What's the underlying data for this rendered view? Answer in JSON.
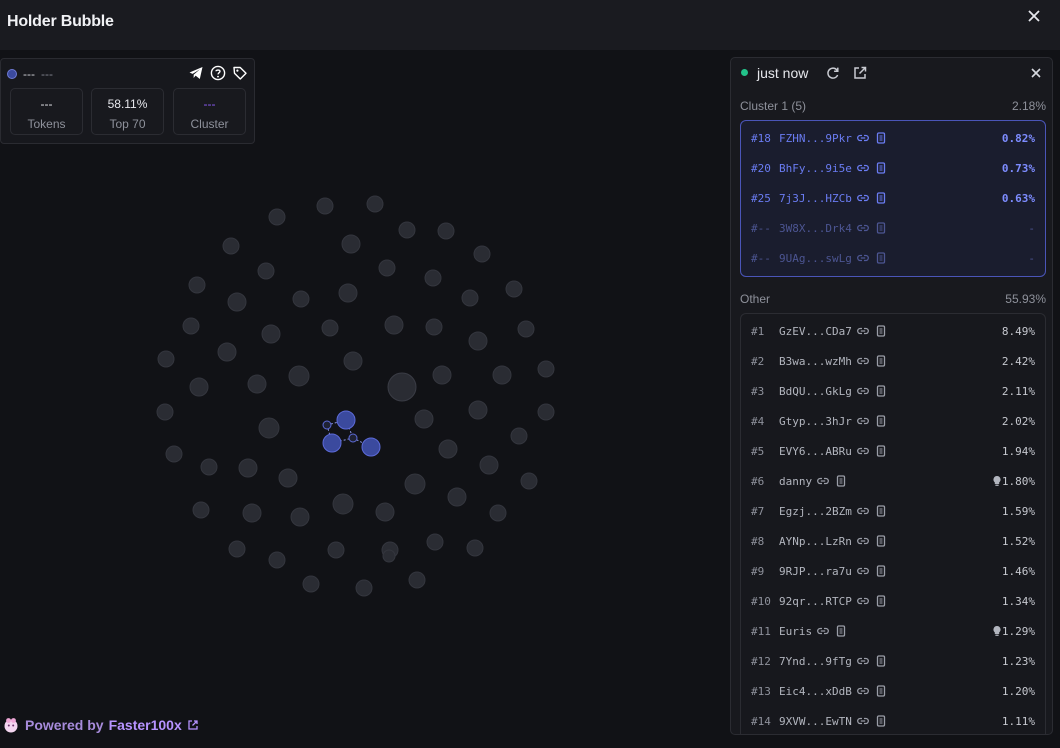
{
  "window": {
    "title": "Holder Bubble"
  },
  "stats": {
    "head_left": "---",
    "head_right": "---",
    "boxes": [
      {
        "value": "---",
        "label": "Tokens"
      },
      {
        "value": "58.11%",
        "label": "Top 70"
      },
      {
        "value": "---",
        "label": "Cluster"
      }
    ]
  },
  "footer": {
    "prefix": "Powered by",
    "brand": "Faster100x"
  },
  "panel": {
    "status": "just now",
    "cluster": {
      "title": "Cluster 1 (5)",
      "total": "2.18%",
      "rows": [
        {
          "rank": "#18",
          "addr": "FZHN...9Pkr",
          "pct": "0.82%"
        },
        {
          "rank": "#20",
          "addr": "BhFy...9i5e",
          "pct": "0.73%"
        },
        {
          "rank": "#25",
          "addr": "7j3J...HZCb",
          "pct": "0.63%"
        },
        {
          "rank": "#--",
          "addr": "3W8X...Drk4",
          "pct": "-"
        },
        {
          "rank": "#--",
          "addr": "9UAg...swLg",
          "pct": "-"
        }
      ]
    },
    "other": {
      "title": "Other",
      "total": "55.93%",
      "rows": [
        {
          "rank": "#1",
          "addr": "GzEV...CDa7",
          "pct": "8.49%"
        },
        {
          "rank": "#2",
          "addr": "B3wa...wzMh",
          "pct": "2.42%"
        },
        {
          "rank": "#3",
          "addr": "BdQU...GkLg",
          "pct": "2.11%"
        },
        {
          "rank": "#4",
          "addr": "Gtyp...3hJr",
          "pct": "2.02%"
        },
        {
          "rank": "#5",
          "addr": "EVY6...ABRu",
          "pct": "1.94%"
        },
        {
          "rank": "#6",
          "addr": "danny",
          "pct": "1.80%",
          "bulb": true
        },
        {
          "rank": "#7",
          "addr": "Egzj...2BZm",
          "pct": "1.59%"
        },
        {
          "rank": "#8",
          "addr": "AYNp...LzRn",
          "pct": "1.52%"
        },
        {
          "rank": "#9",
          "addr": "9RJP...ra7u",
          "pct": "1.46%"
        },
        {
          "rank": "#10",
          "addr": "92qr...RTCP",
          "pct": "1.34%"
        },
        {
          "rank": "#11",
          "addr": "Euris",
          "pct": "1.29%",
          "bulb": true
        },
        {
          "rank": "#12",
          "addr": "7Ynd...9fTg",
          "pct": "1.23%"
        },
        {
          "rank": "#13",
          "addr": "Eic4...xDdB",
          "pct": "1.20%"
        },
        {
          "rank": "#14",
          "addr": "9XVW...EwTN",
          "pct": "1.11%"
        }
      ]
    }
  },
  "colors": {
    "bubble": "#2a2c33",
    "cluster_bubble": "#3b4a9e",
    "accent": "#6a7cf2",
    "live": "#22c38a",
    "brand": "#b693ff"
  }
}
